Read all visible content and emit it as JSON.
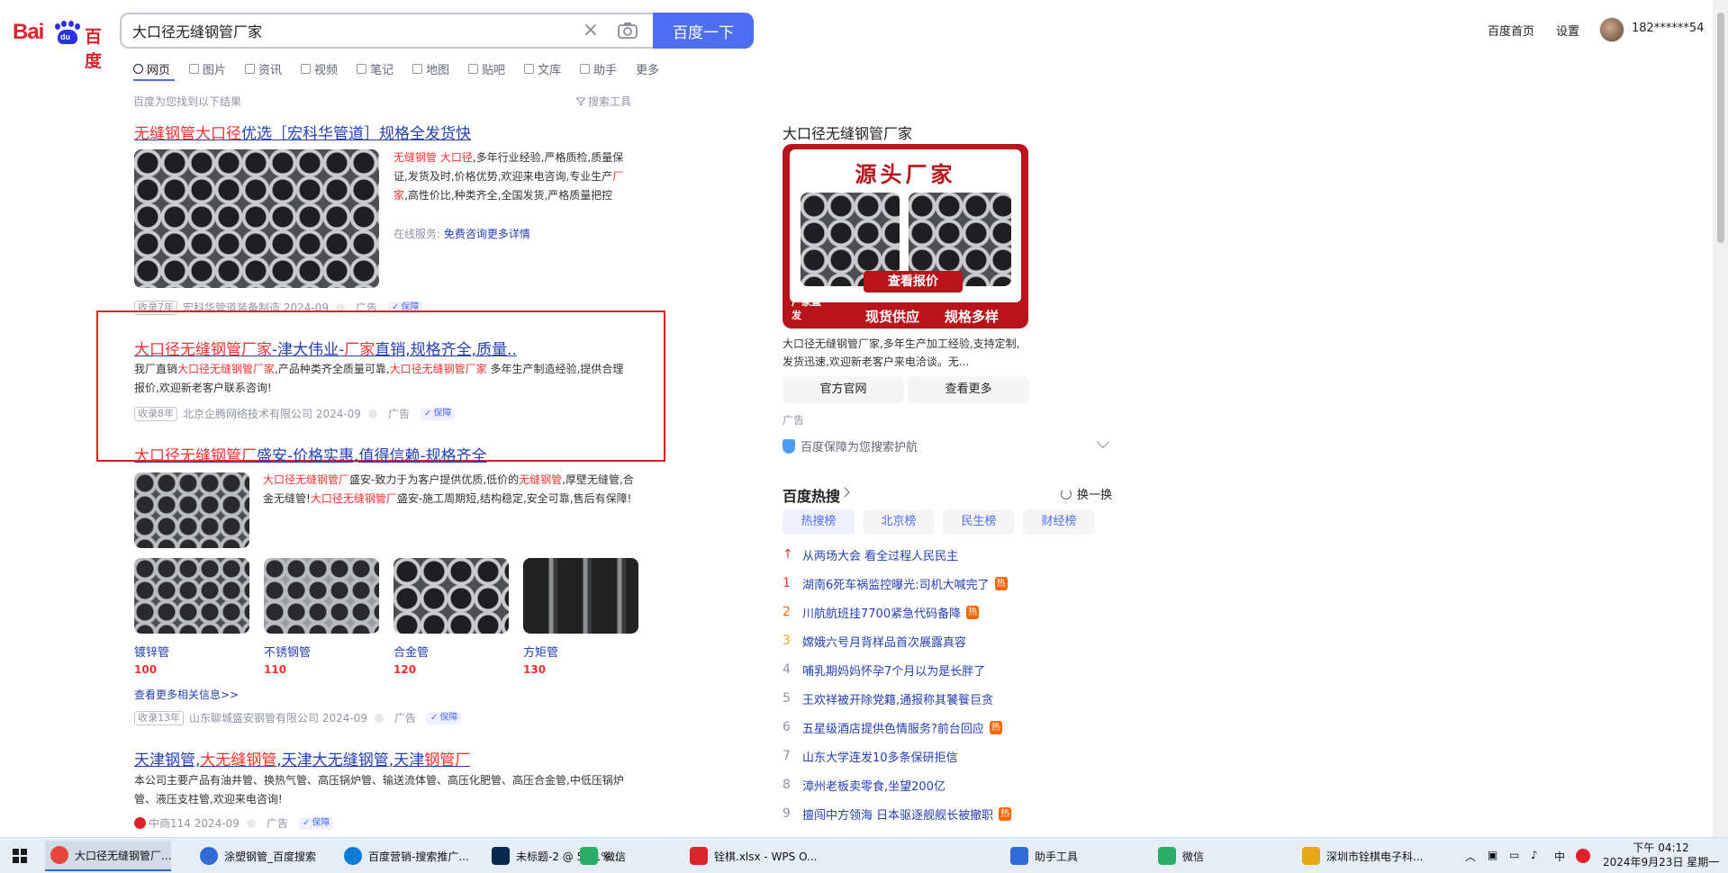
{
  "header": {
    "logo_bai": "Bai",
    "logo_du": "du",
    "logo_cn": "百度",
    "search_value": "大口径无缝钢管厂家",
    "search_button": "百度一下",
    "home_link": "百度首页",
    "settings_link": "设置",
    "username": "182******54"
  },
  "tabs": [
    "网页",
    "图片",
    "资讯",
    "视频",
    "笔记",
    "地图",
    "贴吧",
    "文库",
    "助手",
    "更多"
  ],
  "result_count": "百度为您找到以下结果",
  "search_tools": "搜索工具",
  "results": {
    "r1": {
      "title_a": "无缝钢管大口径",
      "title_b": "优选［宏科华管道］规格全发货快",
      "text_hl1": "无缝钢管",
      "text_hl2": "大口径",
      "text_1": ",多年行业经验,严格质检,质量保证,发货及时,价格优势,欢迎来电咨询,专业生产",
      "text_hl3": "厂家",
      "text_2": ",高性价比,种类齐全,全国发货,严格质量把控",
      "service_label": "在线服务:",
      "service_link": "免费咨询更多详情",
      "tag": "收录7年",
      "source": "宏科华管道装备制造 2024-09",
      "ad": "广告",
      "bao": "保障"
    },
    "r2": {
      "title_a": "大口径无缝钢管厂家",
      "title_b": "-津大伟业-",
      "title_c": "厂家",
      "title_d": "直销,规格齐全,质量..",
      "text_1": "我厂直销",
      "text_hl1": "大口径无缝钢管厂家",
      "text_2": ",产品种类齐全质量可靠,",
      "text_hl2": "大口径无缝钢管厂家",
      "text_3": " 多年生产制造经验,提供合理报价,欢迎新老客户联系咨询!",
      "tag": "收录8年",
      "source": "北京企腾网络技术有限公司 2024-09",
      "ad": "广告",
      "bao": "保障"
    },
    "r3": {
      "title_a": "大口径无缝钢管厂",
      "title_b": "盛安-价格实惠,值得信赖-规格齐全",
      "text_hl1": "大口径无缝钢管厂",
      "text_1": "盛安-致力于为客户提供优质,低价的",
      "text_hl2": "无缝钢管",
      "text_2": ",厚壁无缝管,合金无缝管!",
      "text_hl3": "大口径无缝钢管厂",
      "text_3": "盛安-施工周期短,结构稳定,安全可靠,售后有保障!",
      "thumbs": [
        {
          "label": "镀锌管",
          "price": "100"
        },
        {
          "label": "不锈钢管",
          "price": "110"
        },
        {
          "label": "合金管",
          "price": "120"
        },
        {
          "label": "方矩管",
          "price": "130"
        }
      ],
      "more": "查看更多相关信息>>",
      "tag": "收录13年",
      "source": "山东聊城盛安钢管有限公司 2024-09",
      "ad": "广告",
      "bao": "保障"
    },
    "r4": {
      "title_a": "天津钢管,",
      "title_b": "大无缝钢管",
      "title_c": ",天津大无缝钢管,天津",
      "title_d": "钢管厂",
      "text": "本公司主要产品有油井管、换热气管、高压锅炉管、输送流体管、高压化肥管、高压合金管,中低压锅炉管、液压支柱管,欢迎来电咨询!",
      "source": "中商114 2024-09",
      "ad": "广告",
      "bao": "保障"
    }
  },
  "side_ad": {
    "title": "大口径无缝钢管厂家",
    "banner_head": "源头厂家",
    "banner_quote": "查看报价",
    "banner_corner": "厂家直发",
    "banner_feat1": "现货供应",
    "banner_feat2": "规格多样",
    "desc": "大口径无缝钢管厂家,多年生产加工经验,支持定制,发货迅速,欢迎新老客户来电洽谈。无...",
    "btn_official": "官方官网",
    "btn_more": "查看更多",
    "ad_mark": "广告",
    "protect": "百度保障为您搜索护航"
  },
  "hot": {
    "title": "百度热搜",
    "refresh": "换一换",
    "tabs": [
      "热搜榜",
      "北京榜",
      "民生榜",
      "财经榜"
    ],
    "items": [
      {
        "rank": "↑",
        "text": "从两场大会 看全过程人民民主",
        "badge": ""
      },
      {
        "rank": "1",
        "text": "湖南6死车祸监控曝光:司机大喊完了",
        "badge": "热"
      },
      {
        "rank": "2",
        "text": "川航航班挂7700紧急代码备降",
        "badge": "热"
      },
      {
        "rank": "3",
        "text": "嫦娥六号月背样品首次展露真容",
        "badge": ""
      },
      {
        "rank": "4",
        "text": "哺乳期妈妈怀孕7个月以为是长胖了",
        "badge": ""
      },
      {
        "rank": "5",
        "text": "王欢祥被开除党籍,通报称其饕餮巨贪",
        "badge": ""
      },
      {
        "rank": "6",
        "text": "五星级酒店提供色情服务?前台回应",
        "badge": "热"
      },
      {
        "rank": "7",
        "text": "山东大学连发10多条保研拒信",
        "badge": ""
      },
      {
        "rank": "8",
        "text": "漳州老板卖零食,坐望200亿",
        "badge": ""
      },
      {
        "rank": "9",
        "text": "擅闯中方领海 日本驱逐舰舰长被撤职",
        "badge": "热"
      }
    ]
  },
  "taskbar": {
    "items": [
      {
        "label": "大口径无缝钢管厂...",
        "color": "#e8453c"
      },
      {
        "label": "涂塑钢管_百度搜索",
        "color": "#2f6bd8"
      },
      {
        "label": "百度营销-搜索推广...",
        "color": "#0f7bd9"
      },
      {
        "label": "未标题-2 @ 55.1%...",
        "color": "#0a2a4f"
      },
      {
        "label": "微信",
        "color": "#2aae67"
      },
      {
        "label": "铨棋.xlsx - WPS O...",
        "color": "#d9262c"
      },
      {
        "label": "助手工具",
        "color": "#2f6bd8"
      },
      {
        "label": "微信",
        "color": "#2aae67"
      },
      {
        "label": "深圳市铨棋电子科...",
        "color": "#e6a817"
      }
    ],
    "ime": "中",
    "time_top": "下午 04:12",
    "time_bottom": "2024年9月23日 星期一"
  }
}
